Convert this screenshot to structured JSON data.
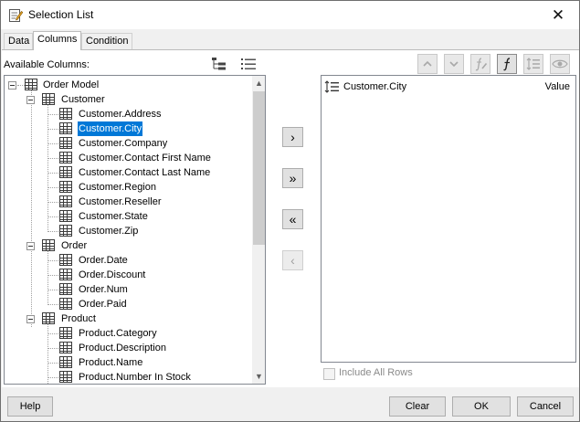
{
  "window": {
    "title": "Selection List",
    "close_glyph": "✕"
  },
  "tabs": [
    {
      "label": "Data"
    },
    {
      "label": "Columns"
    },
    {
      "label": "Condition"
    }
  ],
  "available": {
    "label": "Available Columns:"
  },
  "tree": {
    "root": "Order Model",
    "groups": [
      {
        "name": "Customer",
        "items": [
          "Customer.Address",
          "Customer.City",
          "Customer.Company",
          "Customer.Contact First Name",
          "Customer.Contact Last Name",
          "Customer.Region",
          "Customer.Reseller",
          "Customer.State",
          "Customer.Zip"
        ]
      },
      {
        "name": "Order",
        "items": [
          "Order.Date",
          "Order.Discount",
          "Order.Num",
          "Order.Paid"
        ]
      },
      {
        "name": "Product",
        "items": [
          "Product.Category",
          "Product.Description",
          "Product.Name",
          "Product.Number In Stock"
        ]
      }
    ],
    "selected": "Customer.City"
  },
  "movers": {
    "add": "›",
    "add_all": "»",
    "remove_all": "«",
    "remove": "‹"
  },
  "toolbar_icons": [
    "move-up-icon",
    "move-down-icon",
    "formula-edit-icon",
    "function-icon",
    "sort-icon",
    "visibility-icon"
  ],
  "selected_columns": [
    {
      "name": "Customer.City",
      "type": "Value"
    }
  ],
  "include_all_rows": {
    "label": "Include All Rows",
    "checked": false
  },
  "buttons": {
    "help": "Help",
    "clear": "Clear",
    "ok": "OK",
    "cancel": "Cancel"
  }
}
